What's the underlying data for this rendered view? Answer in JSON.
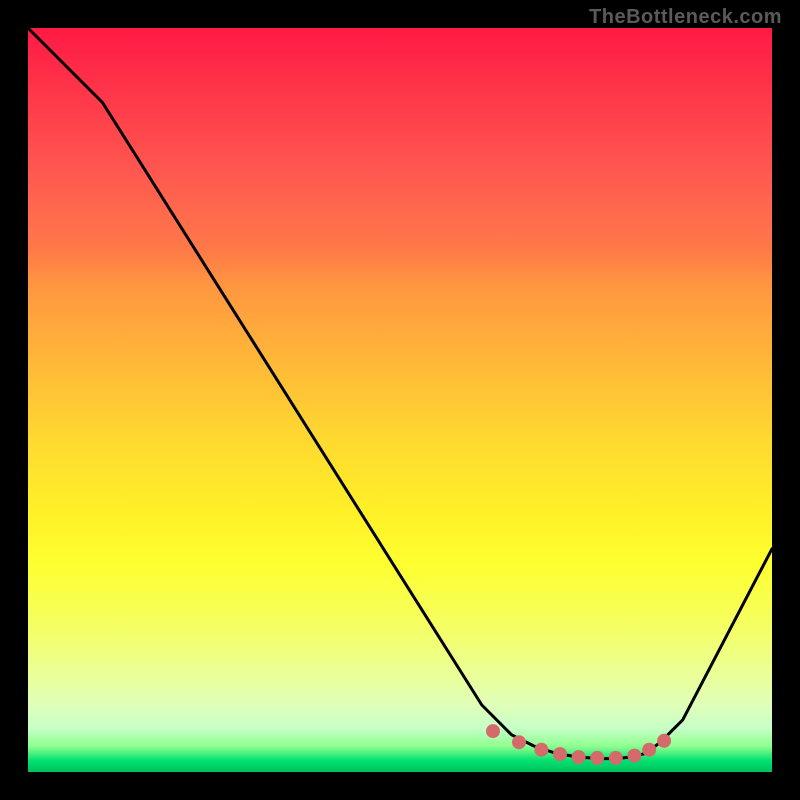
{
  "attribution": "TheBottleneck.com",
  "chart_data": {
    "type": "line",
    "title": "",
    "xlabel": "",
    "ylabel": "",
    "xlim": [
      0,
      1
    ],
    "ylim": [
      0,
      1
    ],
    "series": [
      {
        "name": "curve",
        "x": [
          0.0,
          0.1,
          0.61,
          0.65,
          0.68,
          0.71,
          0.74,
          0.77,
          0.79,
          0.81,
          0.83,
          0.85,
          0.88,
          1.0
        ],
        "y": [
          1.0,
          0.9,
          0.09,
          0.05,
          0.035,
          0.025,
          0.02,
          0.018,
          0.018,
          0.02,
          0.025,
          0.04,
          0.07,
          0.3
        ],
        "stroke": "#000000"
      },
      {
        "name": "markers",
        "x": [
          0.625,
          0.66,
          0.69,
          0.715,
          0.74,
          0.765,
          0.79,
          0.815,
          0.835,
          0.855
        ],
        "y": [
          0.055,
          0.04,
          0.03,
          0.024,
          0.02,
          0.019,
          0.019,
          0.022,
          0.03,
          0.042
        ],
        "stroke": "#d46a6a"
      }
    ]
  }
}
